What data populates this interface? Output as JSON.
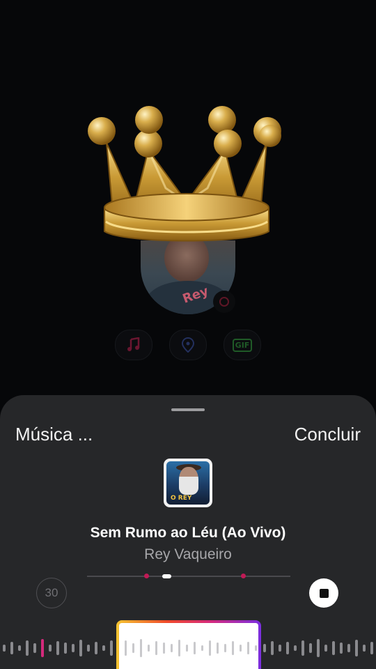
{
  "story": {
    "stickers": [
      {
        "name": "music-sticker-icon",
        "color": "#5e1626"
      },
      {
        "name": "location-pin-icon",
        "color": "#23305e"
      },
      {
        "name": "gif-sticker-icon",
        "label": "GIF",
        "color": "#1f5a27"
      }
    ],
    "overlay": "crown-sticker",
    "avatar_shirt_text": "Rey"
  },
  "music_sheet": {
    "title": "Música ...",
    "done_label": "Concluir",
    "cover_text": "O REY",
    "song_title": "Sem Rumo ao Léu (Ao Vivo)",
    "artist": "Rey Vaqueiro",
    "duration": "30",
    "colors": {
      "sheet_bg": "#262729",
      "progress_marker": "#c01a55",
      "selector_gradient": [
        "#f4c430",
        "#f04a2a",
        "#d52a7c",
        "#7a2ee0"
      ]
    }
  }
}
